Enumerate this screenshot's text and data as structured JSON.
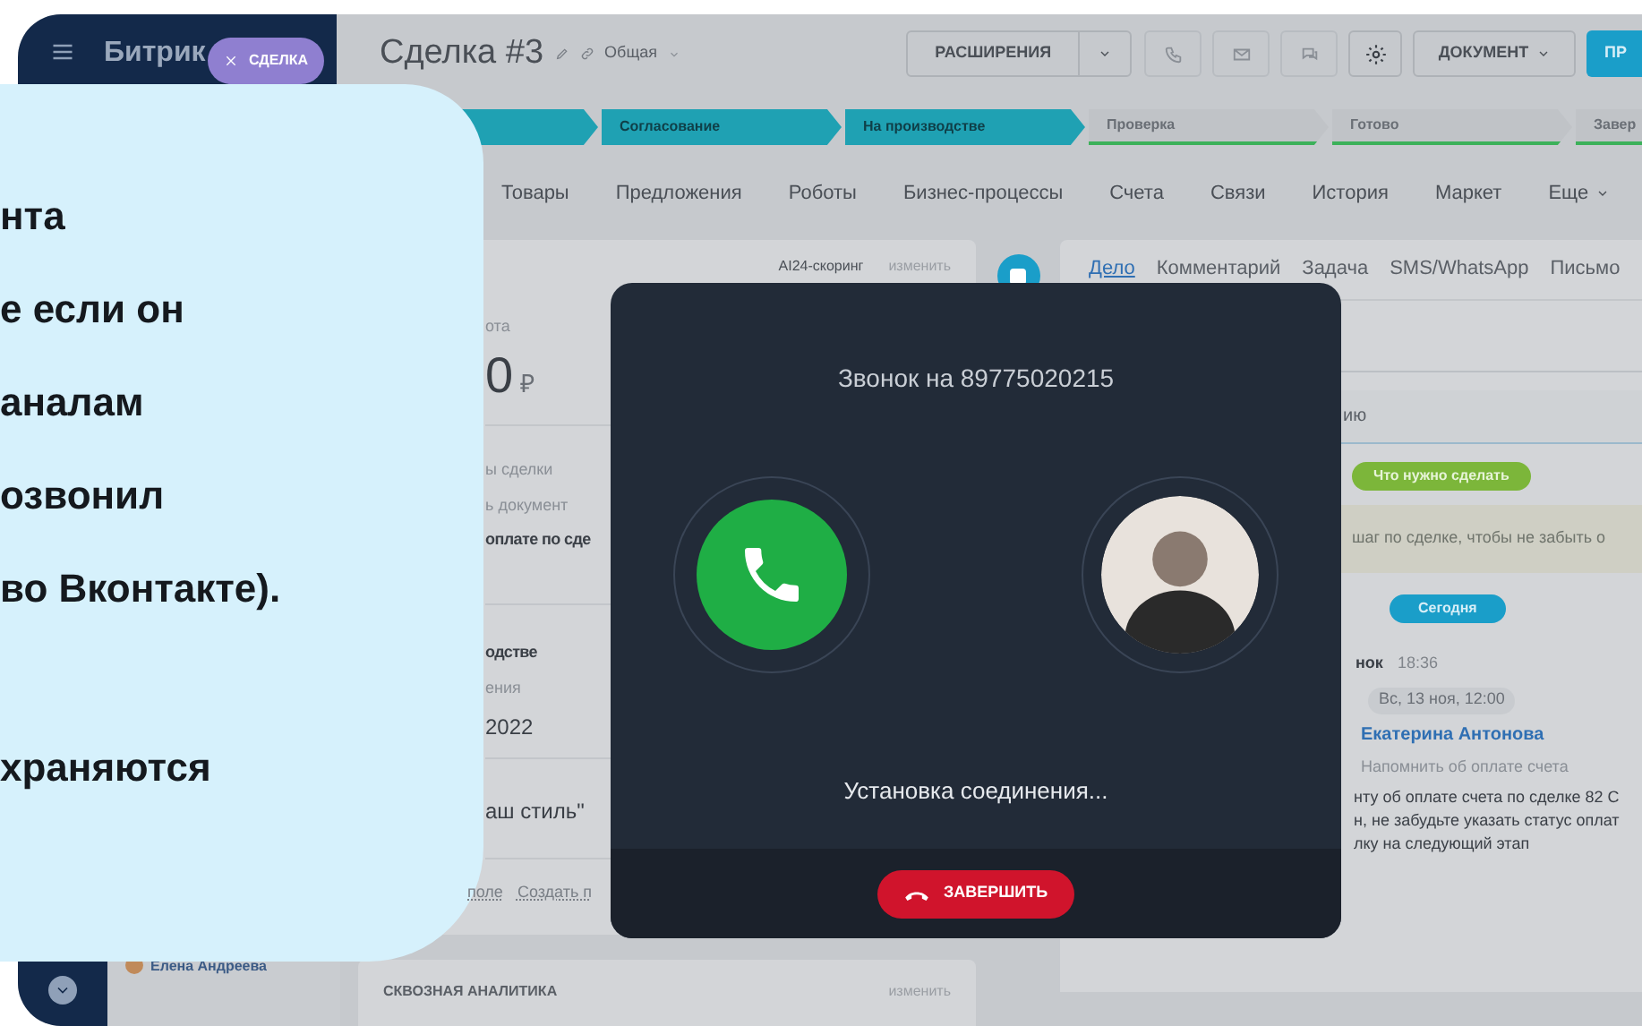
{
  "sidebar": {
    "logo": "Битрик"
  },
  "deal_badge": {
    "label": "СДЕЛКА"
  },
  "header": {
    "title": "Сделка #3",
    "category": "Общая",
    "extensions_button": "РАСШИРЕНИЯ",
    "document_button": "ДОКУМЕНТ",
    "primary_button": "ПР"
  },
  "stages": [
    {
      "done": true
    },
    {
      "label": "Согласование",
      "done": true
    },
    {
      "label": "На производстве",
      "done": true
    },
    {
      "label": "Проверка",
      "done": false
    },
    {
      "label": "Готово",
      "done": false
    },
    {
      "label": "Завер",
      "done": false
    }
  ],
  "tabs": [
    "Товары",
    "Предложения",
    "Роботы",
    "Бизнес-процессы",
    "Счета",
    "Связи",
    "История",
    "Маркет",
    "Еще"
  ],
  "left_card": {
    "scoring_label": "AI24-скоринг",
    "scoring_action": "изменить",
    "sections": [
      [
        {
          "kind": "caption",
          "text": "ота"
        },
        {
          "kind": "amount",
          "text": "0",
          "currency": "₽"
        }
      ],
      [
        {
          "kind": "caption",
          "text": "ы сделки"
        },
        {
          "kind": "caption",
          "text": "ь документ"
        },
        {
          "kind": "bold",
          "text": "оплате по сде"
        }
      ],
      [
        {
          "kind": "bold",
          "text": "одстве"
        },
        {
          "kind": "caption",
          "text": "ения"
        },
        {
          "kind": "value",
          "text": "2022"
        }
      ],
      [
        {
          "kind": "value",
          "text": "аш стиль\""
        }
      ]
    ],
    "links": [
      "поле",
      "Создать п"
    ]
  },
  "responsible": "Елена Андреева",
  "analytics": {
    "title": "СКВОЗНАЯ АНАЛИТИКА",
    "action": "изменить"
  },
  "right_card": {
    "tabs": [
      {
        "label": "Дело",
        "selected": true
      },
      {
        "label": "Комментарий",
        "selected": false
      },
      {
        "label": "Задача",
        "selected": false
      },
      {
        "label": "SMS/WhatsApp",
        "selected": false
      },
      {
        "label": "Письмо",
        "selected": false
      }
    ],
    "comment_field": "ию",
    "todo_badge": "Что нужно сделать",
    "hint": "шаг по сделке, чтобы не забыть о",
    "today_badge": "Сегодня",
    "activity": {
      "title": "нок",
      "time": "18:36",
      "date": "Вс, 13 ноя, 12:00",
      "person": "Екатерина Антонова",
      "subject": "Напомнить об оплате счета",
      "body": [
        "нту об оплате счета по сделке 82 С",
        "н, не забудьте указать статус оплат",
        "лку на следующий этап"
      ]
    }
  },
  "bubble": {
    "paragraphs": [
      [
        "нта",
        "е если он",
        "аналам",
        "озвонил",
        "во Вконтакте)."
      ],
      [
        "храняются"
      ]
    ]
  },
  "call": {
    "title": "Звонок на 89775020215",
    "status": "Установка соединения...",
    "end_button": "ЗАВЕРШИТЬ"
  }
}
